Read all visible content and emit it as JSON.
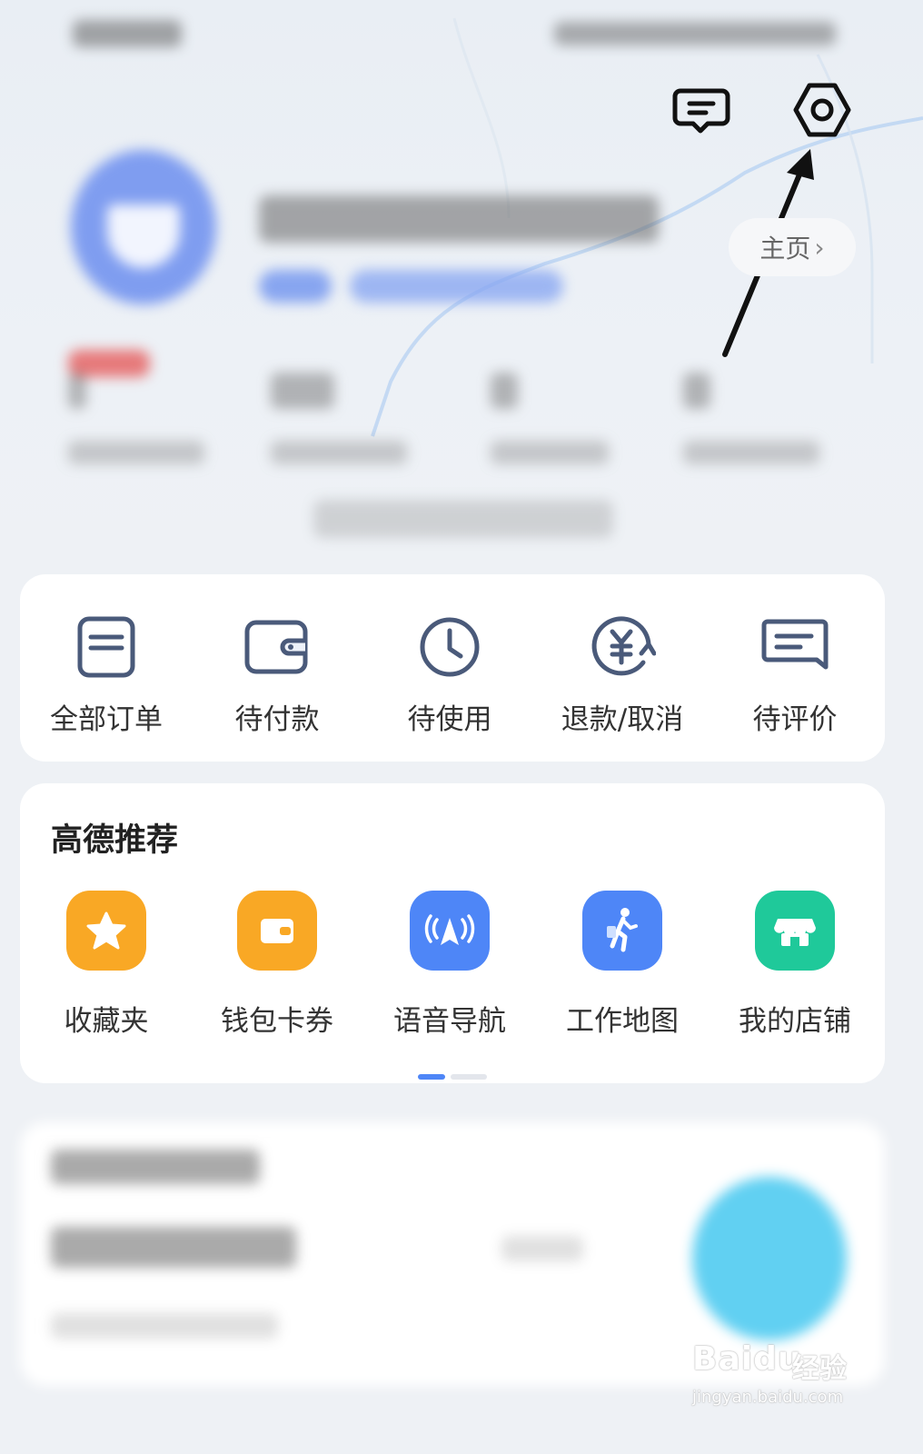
{
  "header": {
    "message_icon": "message-icon",
    "settings_icon": "settings-hexagon-icon",
    "homepage_label": "主页",
    "homepage_chevron": "›"
  },
  "orders": {
    "items": [
      {
        "label": "全部订单",
        "icon": "order-list-icon"
      },
      {
        "label": "待付款",
        "icon": "wallet-icon"
      },
      {
        "label": "待使用",
        "icon": "clock-icon"
      },
      {
        "label": "退款/取消",
        "icon": "yuan-refund-icon"
      },
      {
        "label": "待评价",
        "icon": "comment-icon"
      }
    ]
  },
  "recommend": {
    "title": "高德推荐",
    "items": [
      {
        "label": "收藏夹",
        "icon": "star-icon",
        "color": "#f9a825"
      },
      {
        "label": "钱包卡券",
        "icon": "wallet-card-icon",
        "color": "#f9a825"
      },
      {
        "label": "语音导航",
        "icon": "voice-navigation-icon",
        "color": "#4e86f7"
      },
      {
        "label": "工作地图",
        "icon": "walking-person-icon",
        "color": "#4e86f7"
      },
      {
        "label": "我的店铺",
        "icon": "shop-icon",
        "color": "#1fc99a"
      }
    ]
  },
  "colors": {
    "accent": "#4e86f7",
    "icon_stroke": "#4a5a7a"
  },
  "watermark": {
    "logo": "Baidu",
    "cn": "经验",
    "url": "jingyan.baidu.com"
  }
}
